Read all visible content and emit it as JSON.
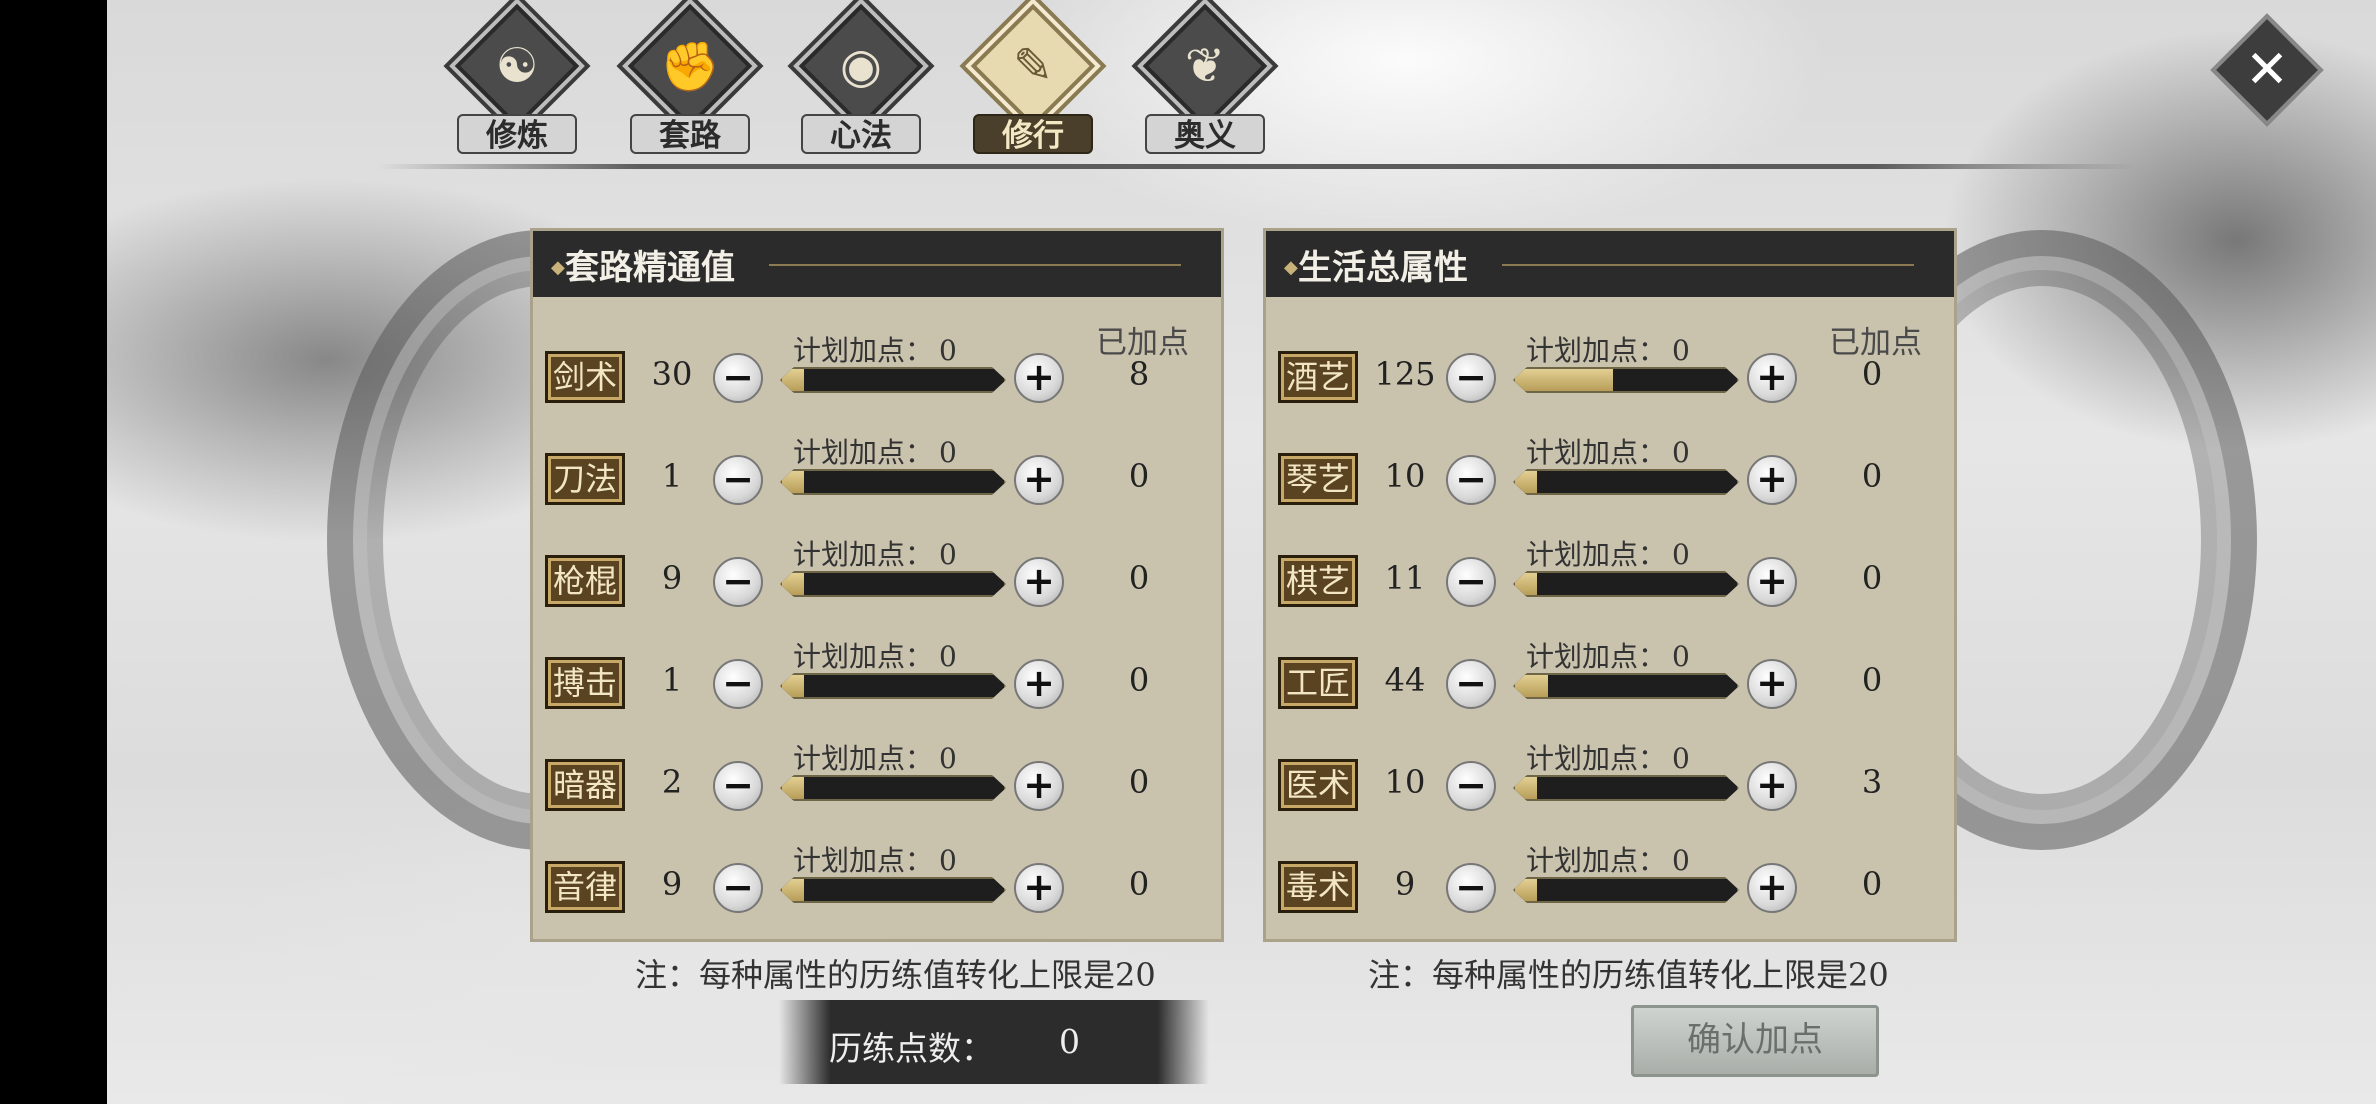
{
  "tabs": [
    {
      "label": "修炼",
      "icon": "cultivation-icon",
      "glyph": "☯"
    },
    {
      "label": "套路",
      "icon": "fist-icon",
      "glyph": "✊"
    },
    {
      "label": "心法",
      "icon": "swirl-icon",
      "glyph": "◉"
    },
    {
      "label": "修行",
      "icon": "scroll-icon",
      "glyph": "✎",
      "active": true
    },
    {
      "label": "奥义",
      "icon": "flame-icon",
      "glyph": "❦"
    }
  ],
  "close_icon": "close-icon",
  "left_panel": {
    "title": "套路精通值",
    "added_header": "已加点",
    "plan_label": "计划加点：",
    "rows": [
      {
        "skill": "剑术",
        "value": "30",
        "plan": "0",
        "fill": 0.1,
        "added": "8"
      },
      {
        "skill": "刀法",
        "value": "1",
        "plan": "0",
        "fill": 0,
        "added": "0"
      },
      {
        "skill": "枪棍",
        "value": "9",
        "plan": "0",
        "fill": 0,
        "added": "0"
      },
      {
        "skill": "搏击",
        "value": "1",
        "plan": "0",
        "fill": 0,
        "added": "0"
      },
      {
        "skill": "暗器",
        "value": "2",
        "plan": "0",
        "fill": 0,
        "added": "0"
      },
      {
        "skill": "音律",
        "value": "9",
        "plan": "0",
        "fill": 0,
        "added": "0"
      }
    ],
    "note": "注：每种属性的历练值转化上限是20"
  },
  "right_panel": {
    "title": "生活总属性",
    "added_header": "已加点",
    "plan_label": "计划加点：",
    "rows": [
      {
        "skill": "酒艺",
        "value": "125",
        "plan": "0",
        "fill": 0.44,
        "added": "0"
      },
      {
        "skill": "琴艺",
        "value": "10",
        "plan": "0",
        "fill": 0,
        "added": "0"
      },
      {
        "skill": "棋艺",
        "value": "11",
        "plan": "0",
        "fill": 0,
        "added": "0"
      },
      {
        "skill": "工匠",
        "value": "44",
        "plan": "0",
        "fill": 0.15,
        "added": "0"
      },
      {
        "skill": "医术",
        "value": "10",
        "plan": "0",
        "fill": 0,
        "added": "3"
      },
      {
        "skill": "毒术",
        "value": "9",
        "plan": "0",
        "fill": 0,
        "added": "0"
      }
    ],
    "note": "注：每种属性的历练值转化上限是20"
  },
  "points": {
    "label": "历练点数：",
    "value": "0"
  },
  "confirm_label": "确认加点",
  "colors": {
    "panel_bg": "#c9c2ad",
    "header_bg": "#2b2b2b",
    "accent_gold": "#c9b27a",
    "skill_badge": "#5a4320"
  }
}
